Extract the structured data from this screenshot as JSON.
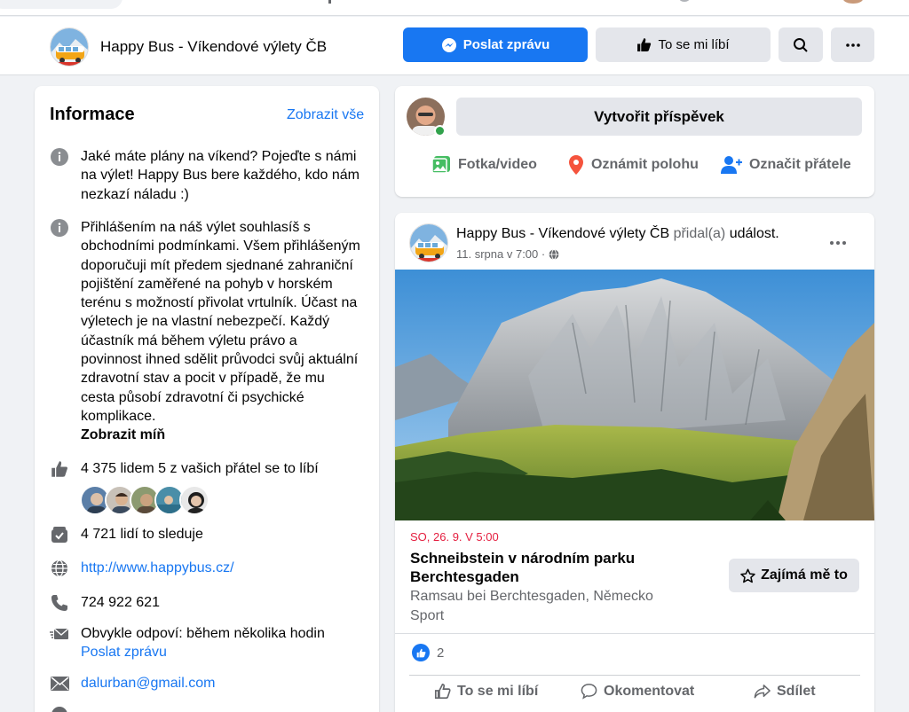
{
  "page": {
    "name": "Happy Bus - Víkendové výlety ČB",
    "send_message": "Poslat zprávu",
    "like_label": "To se mi líbí"
  },
  "info": {
    "title": "Informace",
    "show_all": "Zobrazit vše",
    "about": "Jaké máte plány na víkend? Pojeďte s námi na výlet! Happy Bus bere každého, kdo nám nezkazí náladu :)",
    "terms": "Přihlášením na náš výlet souhlasíš s obchodními podmínkami. Všem přihlášeným doporučuji mít předem sjednané zahraniční pojištění zaměřené na pohyb v horském terénu s možností přivolat vrtulník. Účast na výletech je na vlastní nebezpečí. Každý účastník má během výletu právo a povinnost ihned sdělit průvodci svůj aktuální zdravotní stav a pocit v případě, že mu cesta působí zdravotní či psychické komplikace.",
    "show_less": "Zobrazit míň",
    "likes": "4 375 lidem 5 z vašich přátel se to líbí",
    "followers": "4 721 lidí to sleduje",
    "website": "http://www.happybus.cz/",
    "phone": "724 922 621",
    "response_time": "Obvykle odpoví: během několika hodin",
    "send_message_link": "Poslat zprávu",
    "email": "dalurban@gmail.com"
  },
  "composer": {
    "create_post": "Vytvořit příspěvek",
    "photo_video": "Fotka/video",
    "check_in": "Oznámit polohu",
    "tag_friends": "Označit přátele"
  },
  "post": {
    "author": "Happy Bus - Víkendové výlety ČB",
    "action_verb": "přidal(a)",
    "action_object": "událost.",
    "date": "11. srpna v 7:00 ·",
    "event": {
      "datetime": "SO, 26. 9. V 5:00",
      "title": "Schneibstein v národním parku Berchtesgaden",
      "location": "Ramsau bei Berchtesgaden, Německo",
      "category": "Sport",
      "interested": "Zajímá mě to"
    },
    "reaction_count": "2",
    "like": "To se mi líbí",
    "comment": "Okomentovat",
    "share": "Sdílet"
  },
  "icons": {
    "info": "info-icon",
    "thumb": "thumbs-up-icon",
    "follow": "follow-icon",
    "globe": "globe-icon",
    "phone": "phone-icon",
    "message": "message-icon",
    "mail": "mail-icon"
  },
  "colors": {
    "accent": "#1877f2",
    "event_date": "#e41e3f",
    "online": "#31a24c"
  }
}
